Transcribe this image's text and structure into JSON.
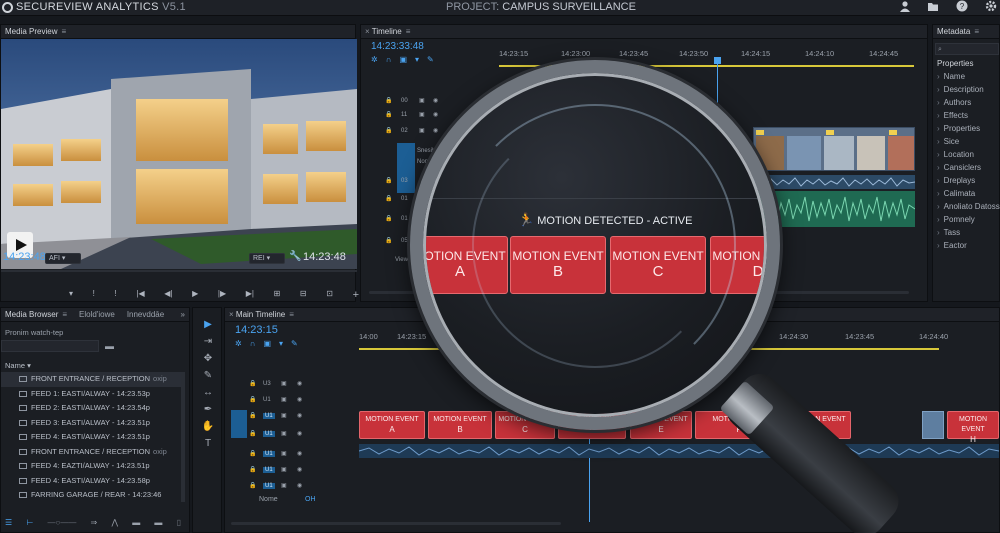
{
  "titlebar": {
    "app_name": "SECUREVIEW ANALYTICS",
    "version": "V5.1",
    "project_label": "PROJECT:",
    "project_name": "CAMPUS SURVEILLANCE"
  },
  "media_preview": {
    "title": "Media Preview",
    "timecode": "14:23:48",
    "timecode_right": "14:23:48",
    "left_dropdown": "AFI",
    "right_dropdown": "REI"
  },
  "timeline": {
    "title": "Timeline",
    "timecode": "14:23:33:48",
    "ruler": [
      "14:23:15",
      "14:23:00",
      "14:23:45",
      "14:23:50",
      "14:24:15",
      "14:24:10",
      "14:24:45"
    ],
    "track_labels": [
      "00",
      "11",
      "02",
      "03",
      "01",
      "01",
      "05"
    ],
    "track_text_a": "Snesib",
    "track_text_b": "Non",
    "track_footer": "Viewi"
  },
  "metadata": {
    "title": "Metadata",
    "section": "Properties",
    "items": [
      "Name",
      "Description",
      "Authors",
      "Effects",
      "Properties",
      "Sice",
      "Location",
      "Cansiclers",
      "Dreplays",
      "Calimata",
      "Anoliato Datoss",
      "Pomnely",
      "Tass",
      "Eactor"
    ]
  },
  "browser": {
    "title": "Media Browser",
    "tab2": "Elold'iowe",
    "tab3": "Innevddāe",
    "search_text": "Pronim watch-tep",
    "col_name": "Name",
    "files": [
      {
        "name": "FRONT ENTRANCE / RECEPTION",
        "ext": "oxip"
      },
      {
        "name": "FEED 1: EASTI/ALWAY - 14:23.53p",
        "ext": ""
      },
      {
        "name": "FEED 2: EASTI/ALWAY - 14:23.54p",
        "ext": ""
      },
      {
        "name": "FEED 3: EASTI/ALWAY - 14:23.51p",
        "ext": ""
      },
      {
        "name": "FEED 4: EASTI/ALWAY - 14:23.51p",
        "ext": ""
      },
      {
        "name": "FRONT ENTRANCE / RECEPTION",
        "ext": "oxip"
      },
      {
        "name": "FEED 4: EAZTI/ALWAY - 14:23.51p",
        "ext": ""
      },
      {
        "name": "FEED 4: EASTI/ALWAY - 14:23.58p",
        "ext": ""
      },
      {
        "name": "FARRING GARAGE / REAR - 14:23:46",
        "ext": ""
      }
    ]
  },
  "main_timeline": {
    "title": "Main Timeline",
    "timecode": "14:23:15",
    "ruler": [
      "14:00",
      "14:23:15",
      "14:23:25",
      "14:23:30",
      "14:23:15",
      "14:24:40",
      "14:24:25",
      "14:24:30",
      "14:23:45",
      "14:24:40"
    ],
    "tracks": [
      "U3",
      "U1",
      "U1",
      "U1",
      "U1",
      "U1",
      "U1"
    ],
    "track_footer_name": "Nome",
    "track_footer_val": "OH",
    "events": [
      {
        "title": "MOTION EVENT",
        "letter": "A"
      },
      {
        "title": "MOTION EVENT",
        "letter": "B"
      },
      {
        "title": "MOTION EVENT",
        "letter": "C"
      },
      {
        "title": "MOTION EVENT",
        "letter": "D"
      },
      {
        "title": "MOTION EVENT",
        "letter": "E"
      },
      {
        "title": "MOTION EVENT",
        "letter": "F"
      },
      {
        "title": "MOTION EVENT",
        "letter": "G"
      },
      {
        "title": "MOTION EVENT",
        "letter": "H"
      }
    ]
  },
  "magnifier": {
    "status": "MOTION DETECTED - ACTIVE",
    "events": [
      {
        "title": "MOTION EVENT",
        "letter": "A"
      },
      {
        "title": "MOTION EVENT",
        "letter": "B"
      },
      {
        "title": "MOTION EVENT",
        "letter": "C"
      },
      {
        "title": "MOTION EVENT",
        "letter": "D"
      }
    ]
  },
  "colors": {
    "accent": "#4aa3f0",
    "event_red": "#c8323a",
    "playhead_yellow": "#d8c83a"
  }
}
